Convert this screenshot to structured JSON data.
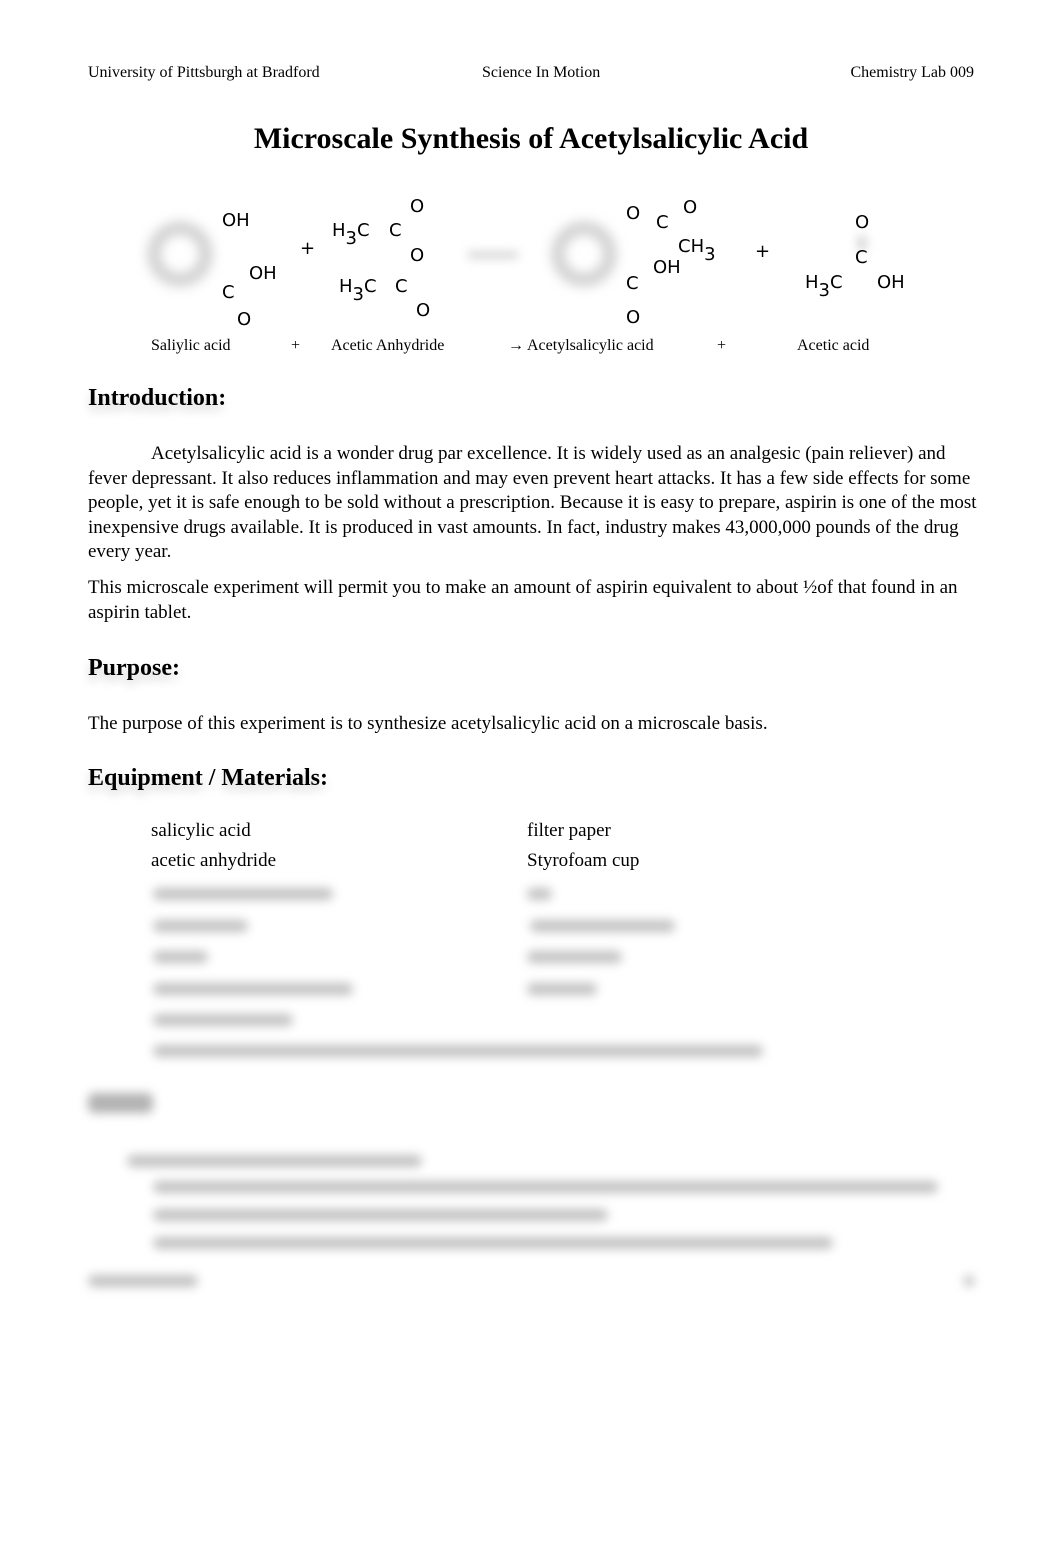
{
  "header": {
    "left": "University of Pittsburgh at Bradford",
    "center": "Science In Motion",
    "right": "Chemistry Lab 009"
  },
  "title": "Microscale Synthesis of Acetylsalicylic Acid",
  "reaction": {
    "salicylic_acid": {
      "oh_top": "OH",
      "oh_side": "OH",
      "c": "C",
      "o": "O"
    },
    "plus1": "+",
    "anhydride": {
      "o_top": "O",
      "h_top": "H",
      "sub3_top": "3",
      "c1_top": "C",
      "c2_top": "C",
      "o_mid": "O",
      "h_bot": "H",
      "sub3_bot": "3",
      "c1_bot": "C",
      "c2_bot": "C",
      "o_bot": "O"
    },
    "product": {
      "o1": "O",
      "c1": "C",
      "o2": "O",
      "ch": "CH",
      "sub3": "3",
      "oh": "OH",
      "c2": "C",
      "o3": "O"
    },
    "plus2": "+",
    "acetic_acid": {
      "o": "O",
      "c": "C",
      "h": "H",
      "sub3": "3",
      "c2": "C",
      "oh": "OH"
    },
    "captions": {
      "reactant1": "Saliylic acid",
      "plus1": "+",
      "reactant2": "Acetic Anhydride",
      "arrow": "→",
      "product1": "Acetylsalicylic acid",
      "plus2": "+",
      "product2": "Acetic acid"
    }
  },
  "introduction": {
    "heading": "Introduction:",
    "para1": "Acetylsalicylic acid is a wonder drug par excellence.  It is widely used as an analgesic (pain reliever) and fever depressant.  It also reduces inflammation and may even prevent heart attacks.  It has a few side effects for some people, yet it is safe enough to be sold without a prescription.  Because it is easy to prepare, aspirin is one of the most inexpensive drugs available.  It is produced in vast amounts.  In fact, industry makes 43,000,000 pounds of the drug every year.",
    "para2": "This microscale experiment will permit you to make an amount of aspirin equivalent to about ½of that found in an aspirin tablet."
  },
  "purpose": {
    "heading": "Purpose:",
    "text": "The purpose of this experiment is to synthesize acetylsalicylic acid on a microscale basis."
  },
  "equipment": {
    "heading": "Equipment / Materials:",
    "left": [
      "salicylic acid",
      "acetic anhydride"
    ],
    "right": [
      "filter paper",
      "Styrofoam cup"
    ]
  }
}
